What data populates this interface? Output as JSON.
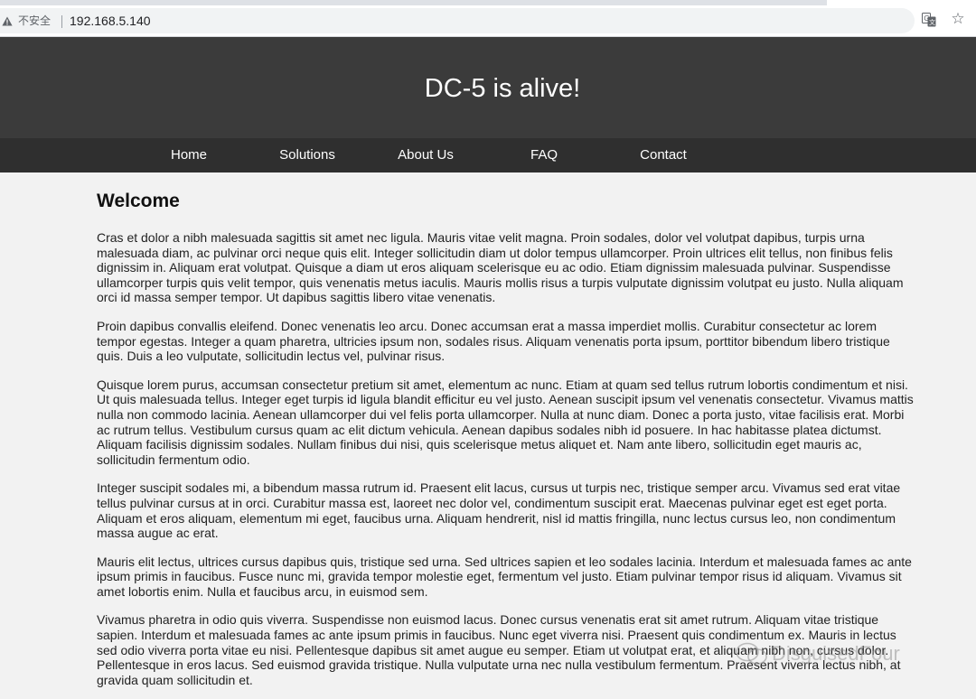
{
  "browser": {
    "security_label": "不安全",
    "url": "192.168.5.140"
  },
  "site": {
    "title": "DC-5 is alive!",
    "nav": [
      "Home",
      "Solutions",
      "About Us",
      "FAQ",
      "Contact"
    ]
  },
  "content": {
    "heading": "Welcome",
    "paragraphs": [
      "Cras et dolor a nibh malesuada sagittis sit amet nec ligula. Mauris vitae velit magna. Proin sodales, dolor vel volutpat dapibus, turpis urna malesuada diam, ac pulvinar orci neque quis elit. Integer sollicitudin diam ut dolor tempus ullamcorper. Proin ultrices elit tellus, non finibus felis dignissim in. Aliquam erat volutpat. Quisque a diam ut eros aliquam scelerisque eu ac odio. Etiam dignissim malesuada pulvinar. Suspendisse ullamcorper turpis quis velit tempor, quis venenatis metus iaculis. Mauris mollis risus a turpis vulputate dignissim volutpat eu justo. Nulla aliquam orci id massa semper tempor. Ut dapibus sagittis libero vitae venenatis.",
      "Proin dapibus convallis eleifend. Donec venenatis leo arcu. Donec accumsan erat a massa imperdiet mollis. Curabitur consectetur ac lorem tempor egestas. Integer a quam pharetra, ultricies ipsum non, sodales risus. Aliquam venenatis porta ipsum, porttitor bibendum libero tristique quis. Duis a leo vulputate, sollicitudin lectus vel, pulvinar risus.",
      "Quisque lorem purus, accumsan consectetur pretium sit amet, elementum ac nunc. Etiam at quam sed tellus rutrum lobortis condimentum et nisi. Ut quis malesuada tellus. Integer eget turpis id ligula blandit efficitur eu vel justo. Aenean suscipit ipsum vel venenatis consectetur. Vivamus mattis nulla non commodo lacinia. Aenean ullamcorper dui vel felis porta ullamcorper. Nulla at nunc diam. Donec a porta justo, vitae facilisis erat. Morbi ac rutrum tellus. Vestibulum cursus quam ac elit dictum vehicula. Aenean dapibus sodales nibh id posuere. In hac habitasse platea dictumst. Aliquam facilisis dignissim sodales. Nullam finibus dui nisi, quis scelerisque metus aliquet et. Nam ante libero, sollicitudin eget mauris ac, sollicitudin fermentum odio.",
      "Integer suscipit sodales mi, a bibendum massa rutrum id. Praesent elit lacus, cursus ut turpis nec, tristique semper arcu. Vivamus sed erat vitae tellus pulvinar cursus at in orci. Curabitur massa est, laoreet nec dolor vel, condimentum suscipit erat. Maecenas pulvinar eget est eget porta. Aliquam et eros aliquam, elementum mi eget, faucibus urna. Aliquam hendrerit, nisl id mattis fringilla, nunc lectus cursus leo, non condimentum massa augue ac erat.",
      "Mauris elit lectus, ultrices cursus dapibus quis, tristique sed urna. Sed ultrices sapien et leo sodales lacinia. Interdum et malesuada fames ac ante ipsum primis in faucibus. Fusce nunc mi, gravida tempor molestie eget, fermentum vel justo. Etiam pulvinar tempor risus id aliquam. Vivamus sit amet lobortis enim. Nulla et faucibus arcu, in euismod sem.",
      "Vivamus pharetra in odio quis viverra. Suspendisse non euismod lacus. Donec cursus venenatis erat sit amet rutrum. Aliquam vitae tristique sapien. Interdum et malesuada fames ac ante ipsum primis in faucibus. Nunc eget viverra nisi. Praesent quis condimentum ex. Mauris in lectus sed odio viverra porta vitae eu nisi. Pellentesque dapibus sit amet augue eu semper. Etiam ut volutpat erat, et aliquam nibh non, cursus dolor. Pellentesque in eros lacus. Sed euismod gravida tristique. Nulla vulputate urna nec nulla vestibulum fermentum. Praesent viverra lectus nibh, at gravida quam sollicitudin et."
    ]
  },
  "watermark": {
    "text": "DisguisedFour"
  },
  "colors": {
    "header_bg": "#3b3b3b",
    "nav_bg": "#2f2f2f",
    "page_bg": "#f2f2f2"
  },
  "icons": [
    "warning-triangle-icon",
    "translate-icon",
    "bookmark-star-icon",
    "wechat-icon"
  ]
}
